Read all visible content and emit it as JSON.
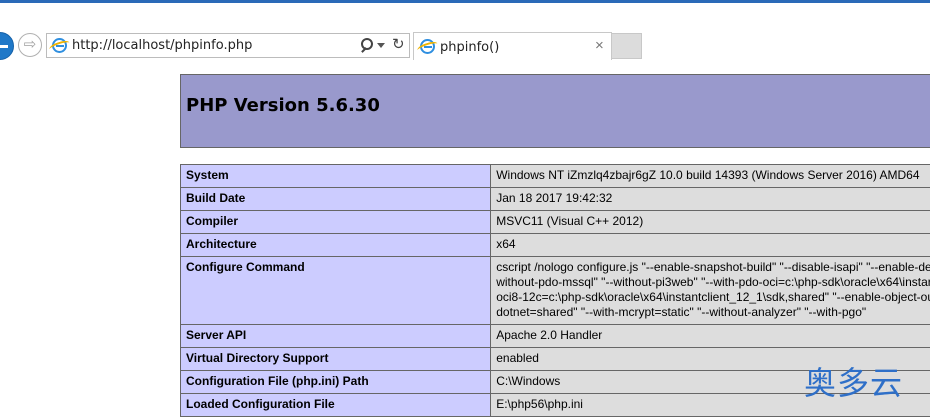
{
  "browser": {
    "address_url": "http://localhost/phpinfo.php",
    "tab_title": "phpinfo()",
    "tab_close": "×",
    "forward_glyph": "⇨",
    "refresh_glyph": "↻",
    "icons": [
      "back-icon",
      "forward-icon",
      "ie-icon",
      "search-icon",
      "dropdown-icon",
      "refresh-icon",
      "close-icon"
    ]
  },
  "php": {
    "title": "PHP Version 5.6.30",
    "rows": [
      {
        "label": "System",
        "value": "Windows NT iZmzlq4zbajr6gZ 10.0 build 14393 (Windows Server 2016) AMD64"
      },
      {
        "label": "Build Date",
        "value": "Jan 18 2017 19:42:32"
      },
      {
        "label": "Compiler",
        "value": "MSVC11 (Visual C++ 2012)"
      },
      {
        "label": "Architecture",
        "value": "x64"
      },
      {
        "label": "Configure Command",
        "lines": [
          "cscript /nologo configure.js \"--enable-snapshot-build\" \"--disable-isapi\" \"--enable-de",
          "without-pdo-mssql\" \"--without-pi3web\" \"--with-pdo-oci=c:\\php-sdk\\oracle\\x64\\instar",
          "oci8-12c=c:\\php-sdk\\oracle\\x64\\instantclient_12_1\\sdk,shared\" \"--enable-object-ou",
          "dotnet=shared\" \"--with-mcrypt=static\" \"--without-analyzer\" \"--with-pgo\""
        ]
      },
      {
        "label": "Server API",
        "value": "Apache 2.0 Handler"
      },
      {
        "label": "Virtual Directory Support",
        "value": "enabled"
      },
      {
        "label": "Configuration File (php.ini) Path",
        "value": "C:\\Windows"
      },
      {
        "label": "Loaded Configuration File",
        "value": "E:\\php56\\php.ini"
      }
    ]
  },
  "watermark": "奥多云",
  "colors": {
    "header_bg": "#9999cc",
    "label_bg": "#ccccff",
    "value_bg": "#dddddd",
    "border": "#666666",
    "accent": "#1f78c8"
  }
}
